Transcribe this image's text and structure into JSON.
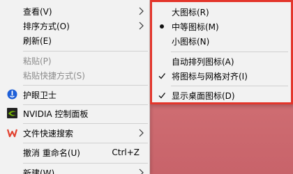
{
  "context_menu": {
    "items": [
      {
        "label": "查看(V)",
        "has_submenu": true
      },
      {
        "label": "排序方式(O)",
        "has_submenu": true
      },
      {
        "label": "刷新(E)"
      },
      {
        "label": "粘贴(P)",
        "disabled": true
      },
      {
        "label": "粘贴快捷方式(S)",
        "disabled": true
      },
      {
        "label": "护眼卫士",
        "icon": "eye-guard-icon"
      },
      {
        "label": "NVIDIA 控制面板",
        "icon": "nvidia-icon"
      },
      {
        "label": "文件快速搜索",
        "icon": "wps-search-icon",
        "has_submenu": true
      },
      {
        "label": "撤消 重命名(U)",
        "shortcut": "Ctrl+Z"
      },
      {
        "label": "新建(W)",
        "has_submenu": true
      }
    ]
  },
  "view_submenu": {
    "highlight_color": "#e3352b",
    "items": [
      {
        "label": "大图标(R)"
      },
      {
        "label": "中等图标(M)",
        "state": "selected-radio"
      },
      {
        "label": "小图标(N)"
      },
      {
        "label": "自动排列图标(A)"
      },
      {
        "label": "将图标与网格对齐(I)",
        "state": "checked"
      },
      {
        "label": "显示桌面图标(D)",
        "state": "checked"
      }
    ]
  },
  "colors": {
    "menu_bg": "#f2f2f2",
    "desktop": "#d17078",
    "disabled_text": "#8c8c8c",
    "accent_blue": "#1e5fd8",
    "nvidia_green": "#76b900",
    "wps_red": "#e2412f"
  }
}
